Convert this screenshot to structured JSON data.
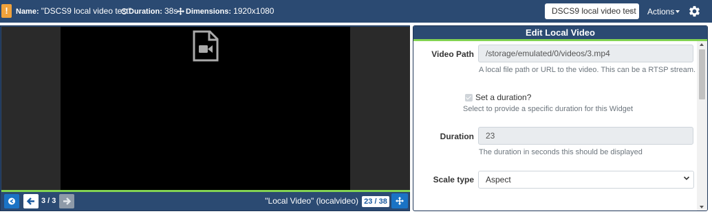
{
  "topbar": {
    "warning_icon": "!",
    "name_label": "Name:",
    "name_value": "\"DSCS9 local video test\"",
    "duration_label": "Duration:",
    "duration_value": "38s",
    "dimensions_label": "Dimensions:",
    "dimensions_value": "1920x1080",
    "layout_select_value": "DSCS9 local video test",
    "actions_label": "Actions",
    "icons": [
      "warning-icon",
      "clock-icon",
      "move-icon",
      "gear-icon"
    ]
  },
  "preview": {
    "media_icon": "file-video-icon",
    "counter": "3 / 3",
    "widget_name": "\"Local Video\" (localvideo)",
    "duration_badge": "23 / 38",
    "nav_icons": [
      "back-circle-icon",
      "arrow-left-icon",
      "arrow-right-icon",
      "arrows-move-icon"
    ]
  },
  "editor": {
    "title": "Edit Local Video",
    "video_path_label": "Video Path",
    "video_path_value": "/storage/emulated/0/videos/3.mp4",
    "video_path_help": "A local file path or URL to the video. This can be a RTSP stream.",
    "set_duration_label": "Set a duration?",
    "set_duration_checked": true,
    "set_duration_help": "Select to provide a specific duration for this Widget",
    "duration_label": "Duration",
    "duration_value": "23",
    "duration_help": "The duration in seconds this should be displayed",
    "scale_type_label": "Scale type",
    "scale_type_value": "Aspect"
  },
  "colors": {
    "topbar": "#2b4a72",
    "accent_green": "#82d352",
    "warning": "#f0a23b",
    "primary_button": "#1a73c5"
  }
}
